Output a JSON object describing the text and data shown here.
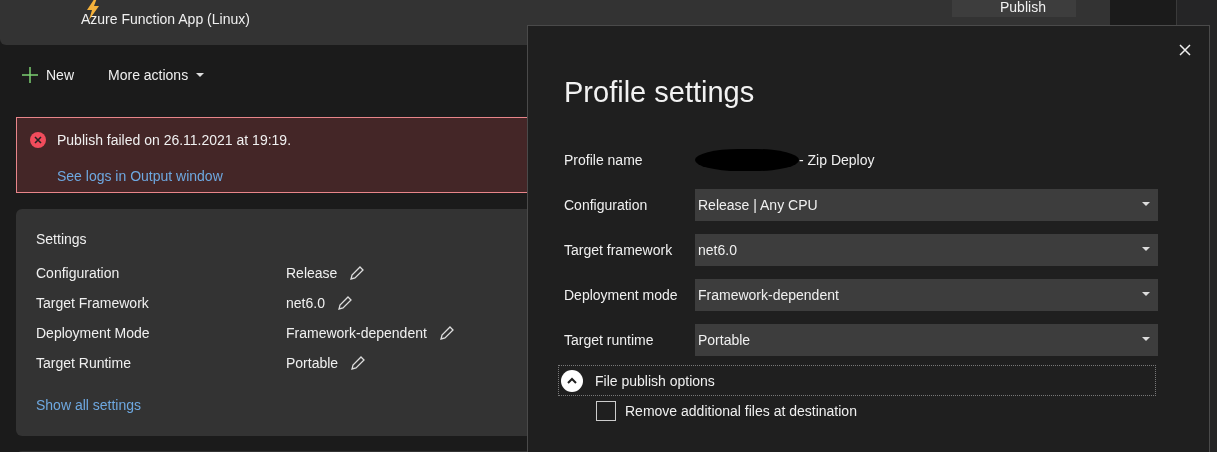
{
  "header": {
    "subtitle": "Azure Function App (Linux)",
    "publish_button": "Publish"
  },
  "toolbar": [
    {
      "kind": "new",
      "label": "New"
    },
    {
      "kind": "menu",
      "label": "More actions"
    }
  ],
  "error": {
    "message": "Publish failed on 26.11.2021 at 19:19.",
    "link": "See logs in Output window"
  },
  "settings": {
    "title": "Settings",
    "rows": [
      {
        "label": "Configuration",
        "value": "Release"
      },
      {
        "label": "Target Framework",
        "value": "net6.0"
      },
      {
        "label": "Deployment Mode",
        "value": "Framework-dependent"
      },
      {
        "label": "Target Runtime",
        "value": "Portable"
      }
    ],
    "link": "Show all settings"
  },
  "dialog": {
    "title": "Profile settings",
    "profile_name": {
      "label": "Profile name",
      "value": "- Zip Deploy",
      "redacted": true
    },
    "fields": [
      {
        "label": "Configuration",
        "value": "Release | Any CPU"
      },
      {
        "label": "Target framework",
        "value": "net6.0"
      },
      {
        "label": "Deployment mode",
        "value": "Framework-dependent"
      },
      {
        "label": "Target runtime",
        "value": "Portable"
      }
    ],
    "expander": {
      "label": "File publish options",
      "expanded": true
    },
    "options": [
      {
        "label": "Remove additional files at destination",
        "checked": false
      }
    ]
  }
}
